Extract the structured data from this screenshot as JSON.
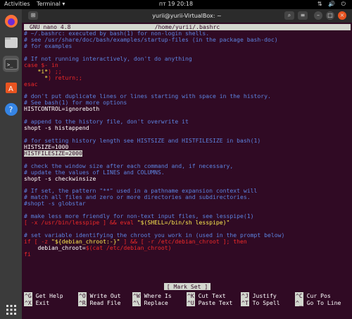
{
  "topbar": {
    "activities": "Activities",
    "app": "Terminal",
    "clock": "пт 19  20:18",
    "tray": "⇅ 🔊 ⏻"
  },
  "titlebar": {
    "title": "yurii@yurii-VirtualBox: ~"
  },
  "nano": {
    "version": "GNU nano 4.8",
    "filename": "/home/yurii/.bashrc",
    "status": "[ Mark Set ]",
    "lines": [
      [
        {
          "t": "# ~/.bashrc: executed by bash(1) for non-login shells.",
          "c": "comment"
        }
      ],
      [
        {
          "t": "# see /usr/share/doc/bash/examples/startup-files (in the package bash-doc)",
          "c": "comment"
        }
      ],
      [
        {
          "t": "# for examples",
          "c": "comment"
        }
      ],
      [],
      [
        {
          "t": "# If not running interactively, don't do anything",
          "c": "comment"
        }
      ],
      [
        {
          "t": "case $- in",
          "c": "kw"
        }
      ],
      [
        {
          "t": "    "
        },
        {
          "t": "*i*",
          "c": "str"
        },
        {
          "t": ") ;;",
          "c": "kw"
        }
      ],
      [
        {
          "t": "      ",
          "c": ""
        },
        {
          "t": "*",
          "c": "str"
        },
        {
          "t": ") return;;",
          "c": "kw"
        }
      ],
      [
        {
          "t": "esac",
          "c": "kw"
        }
      ],
      [],
      [
        {
          "t": "# don't put duplicate lines or lines starting with space in the history.",
          "c": "comment"
        }
      ],
      [
        {
          "t": "# See bash(1) for more options",
          "c": "comment"
        }
      ],
      [
        {
          "t": "HISTCONTROL=ignoreboth"
        }
      ],
      [],
      [
        {
          "t": "# append to the history file, don't overwrite it",
          "c": "comment"
        }
      ],
      [
        {
          "t": "shopt -s histappend"
        }
      ],
      [],
      [
        {
          "t": "# for setting history length see HISTSIZE and HISTFILESIZE in bash(1)",
          "c": "comment"
        }
      ],
      [
        {
          "t": "HISTSIZE=1000"
        }
      ],
      [
        {
          "t": "HISTFILESIZE=2000",
          "c": "sel"
        }
      ],
      [],
      [
        {
          "t": "# check the window size after each command and, if necessary,",
          "c": "comment"
        }
      ],
      [
        {
          "t": "# update the values of LINES and COLUMNS.",
          "c": "comment"
        }
      ],
      [
        {
          "t": "shopt -s checkwinsize"
        }
      ],
      [],
      [
        {
          "t": "# If set, the pattern \"**\" used in a pathname expansion context will",
          "c": "comment"
        }
      ],
      [
        {
          "t": "# match all files and zero or more directories and subdirectories.",
          "c": "comment"
        }
      ],
      [
        {
          "t": "#shopt -s globstar",
          "c": "comment"
        }
      ],
      [],
      [
        {
          "t": "# make less more friendly for non-text input files, see lesspipe(1)",
          "c": "comment"
        }
      ],
      [
        {
          "t": "[ -x /usr/bin/lesspipe ] && eval ",
          "c": "kw"
        },
        {
          "t": "\"$(SHELL=/bin/sh lesspipe)\"",
          "c": "str"
        }
      ],
      [],
      [
        {
          "t": "# set variable identifying the chroot you work in (used in the prompt below)",
          "c": "comment"
        }
      ],
      [
        {
          "t": "if [ -z ",
          "c": "kw"
        },
        {
          "t": "\"${debian_chroot:-}\"",
          "c": "str"
        },
        {
          "t": " ] && [ -r /etc/debian_chroot ]; then",
          "c": "kw"
        }
      ],
      [
        {
          "t": "    debian_chroot="
        },
        {
          "t": "$(cat /etc/debian_chroot)",
          "c": "kw"
        }
      ],
      [
        {
          "t": "fi",
          "c": "kw"
        }
      ]
    ],
    "shortcuts": [
      [
        {
          "k": "^G",
          "l": "Get Help"
        },
        {
          "k": "^O",
          "l": "Write Out"
        },
        {
          "k": "^W",
          "l": "Where Is"
        },
        {
          "k": "^K",
          "l": "Cut Text"
        },
        {
          "k": "^J",
          "l": "Justify"
        },
        {
          "k": "^C",
          "l": "Cur Pos"
        }
      ],
      [
        {
          "k": "^X",
          "l": "Exit"
        },
        {
          "k": "^R",
          "l": "Read File"
        },
        {
          "k": "^\\",
          "l": "Replace"
        },
        {
          "k": "^U",
          "l": "Paste Text"
        },
        {
          "k": "^T",
          "l": "To Spell"
        },
        {
          "k": "^_",
          "l": "Go To Line"
        }
      ]
    ]
  },
  "dock": [
    "firefox-icon",
    "files-icon",
    "terminal-icon",
    "software-icon",
    "help-icon",
    "apps-grid-icon"
  ]
}
